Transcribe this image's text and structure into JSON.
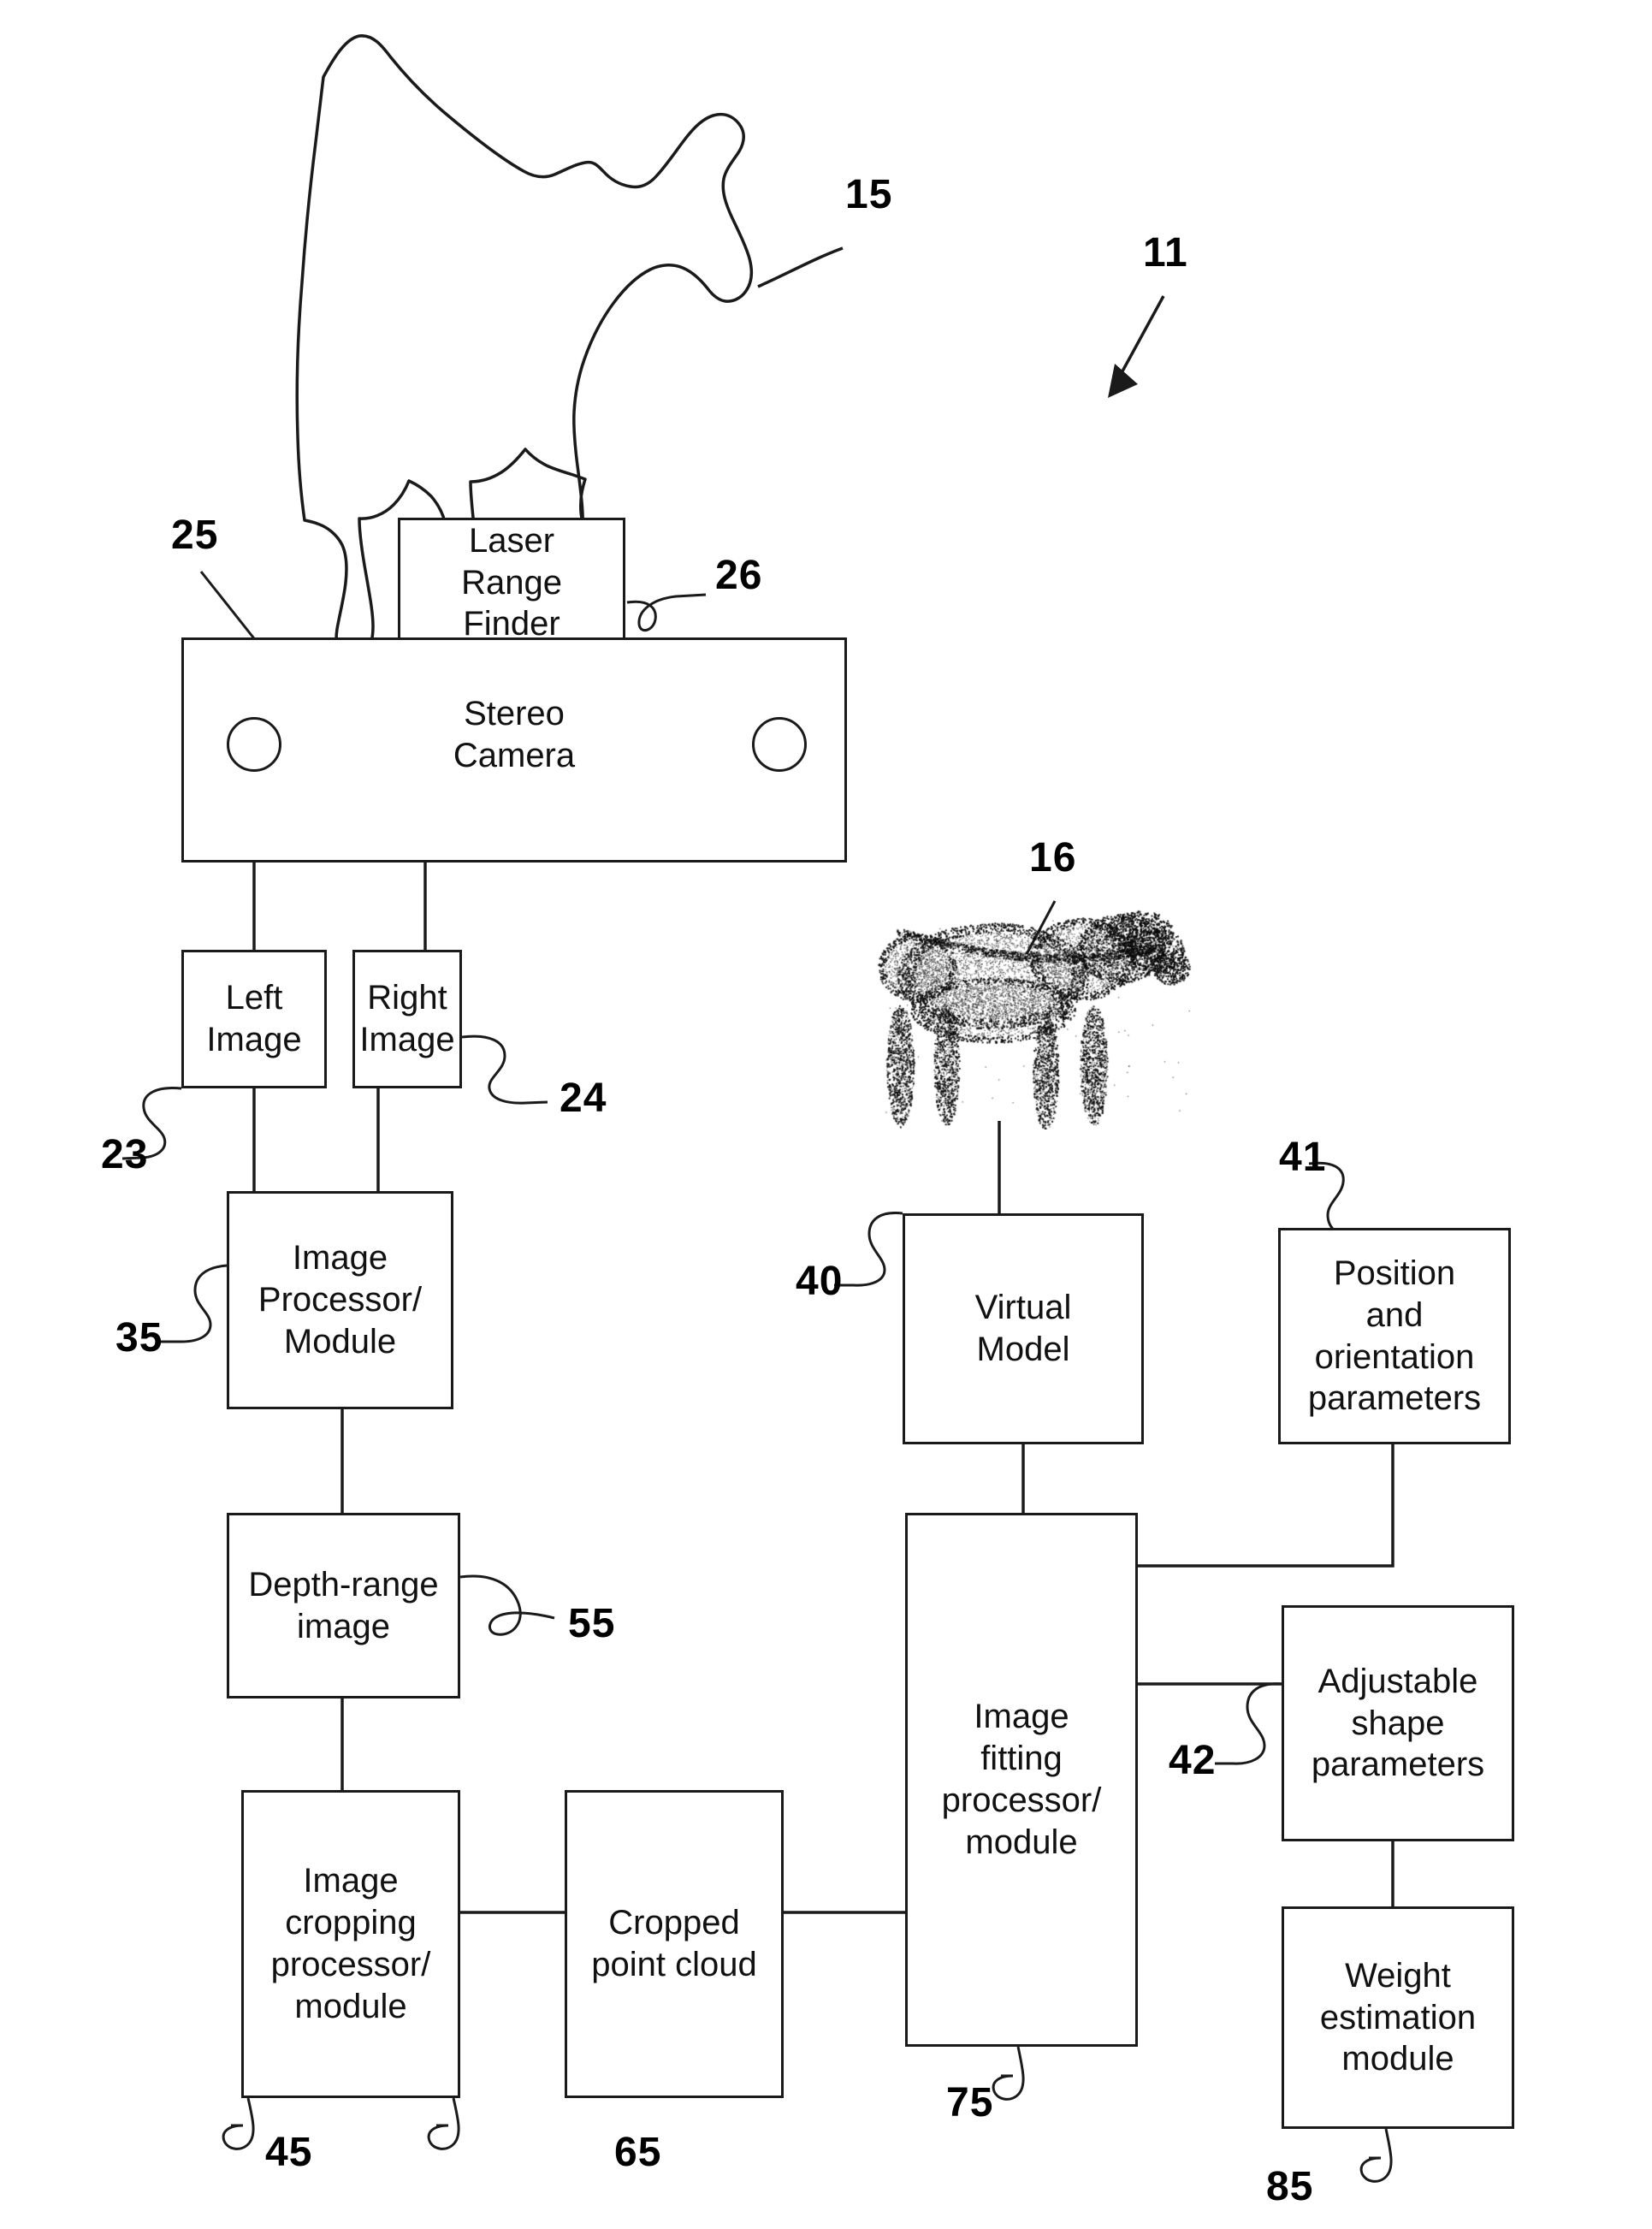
{
  "figure": {
    "system_ref": "11",
    "animal_silhouette_ref": "15",
    "point_cloud_ref": "16"
  },
  "boxes": [
    {
      "id": "laser-range-finder",
      "label": "Laser\nRange\nFinder",
      "ref": "26"
    },
    {
      "id": "stereo-camera",
      "label": "Stereo\nCamera",
      "ref": "25"
    },
    {
      "id": "left-image",
      "label": "Left\nImage",
      "ref": "23"
    },
    {
      "id": "right-image",
      "label": "Right\nImage",
      "ref": "24"
    },
    {
      "id": "image-processor",
      "label": "Image\nProcessor/\nModule",
      "ref": "35"
    },
    {
      "id": "depth-range-image",
      "label": "Depth-range\nimage",
      "ref": "55"
    },
    {
      "id": "image-cropping-processor",
      "label": "Image\ncropping\nprocessor/\nmodule",
      "ref": "45"
    },
    {
      "id": "cropped-point-cloud",
      "label": "Cropped\npoint cloud",
      "ref": "65"
    },
    {
      "id": "virtual-model",
      "label": "Virtual\nModel",
      "ref": "40"
    },
    {
      "id": "image-fitting-processor",
      "label": "Image\nfitting\nprocessor/\nmodule",
      "ref": "75"
    },
    {
      "id": "position-orientation-parameters",
      "label": "Position\nand\norientation\nparameters",
      "ref": "41"
    },
    {
      "id": "adjustable-shape-parameters",
      "label": "Adjustable\nshape\nparameters",
      "ref": "42"
    },
    {
      "id": "weight-estimation-module",
      "label": "Weight\nestimation\nmodule",
      "ref": "85"
    }
  ],
  "labels": {
    "laser_range_finder": "Laser\nRange\nFinder",
    "stereo_camera": "Stereo\nCamera",
    "left_image": "Left\nImage",
    "right_image": "Right\nImage",
    "image_processor": "Image\nProcessor/\nModule",
    "depth_range_image": "Depth-range\nimage",
    "image_cropping_processor": "Image\ncropping\nprocessor/\nmodule",
    "cropped_point_cloud": "Cropped\npoint cloud",
    "virtual_model": "Virtual\nModel",
    "image_fitting_processor": "Image\nfitting\nprocessor/\nmodule",
    "position_orientation_parameters": "Position\nand\norientation\nparameters",
    "adjustable_shape_parameters": "Adjustable\nshape\nparameters",
    "weight_estimation_module": "Weight\nestimation\nmodule"
  },
  "refs": {
    "r11": "11",
    "r15": "15",
    "r16": "16",
    "r23": "23",
    "r24": "24",
    "r25": "25",
    "r26": "26",
    "r35": "35",
    "r40": "40",
    "r41": "41",
    "r42": "42",
    "r45": "45",
    "r55": "55",
    "r65": "65",
    "r75": "75",
    "r85": "85"
  },
  "colors": {
    "line": "#1a1a1a",
    "background": "#ffffff",
    "text": "#111111"
  }
}
